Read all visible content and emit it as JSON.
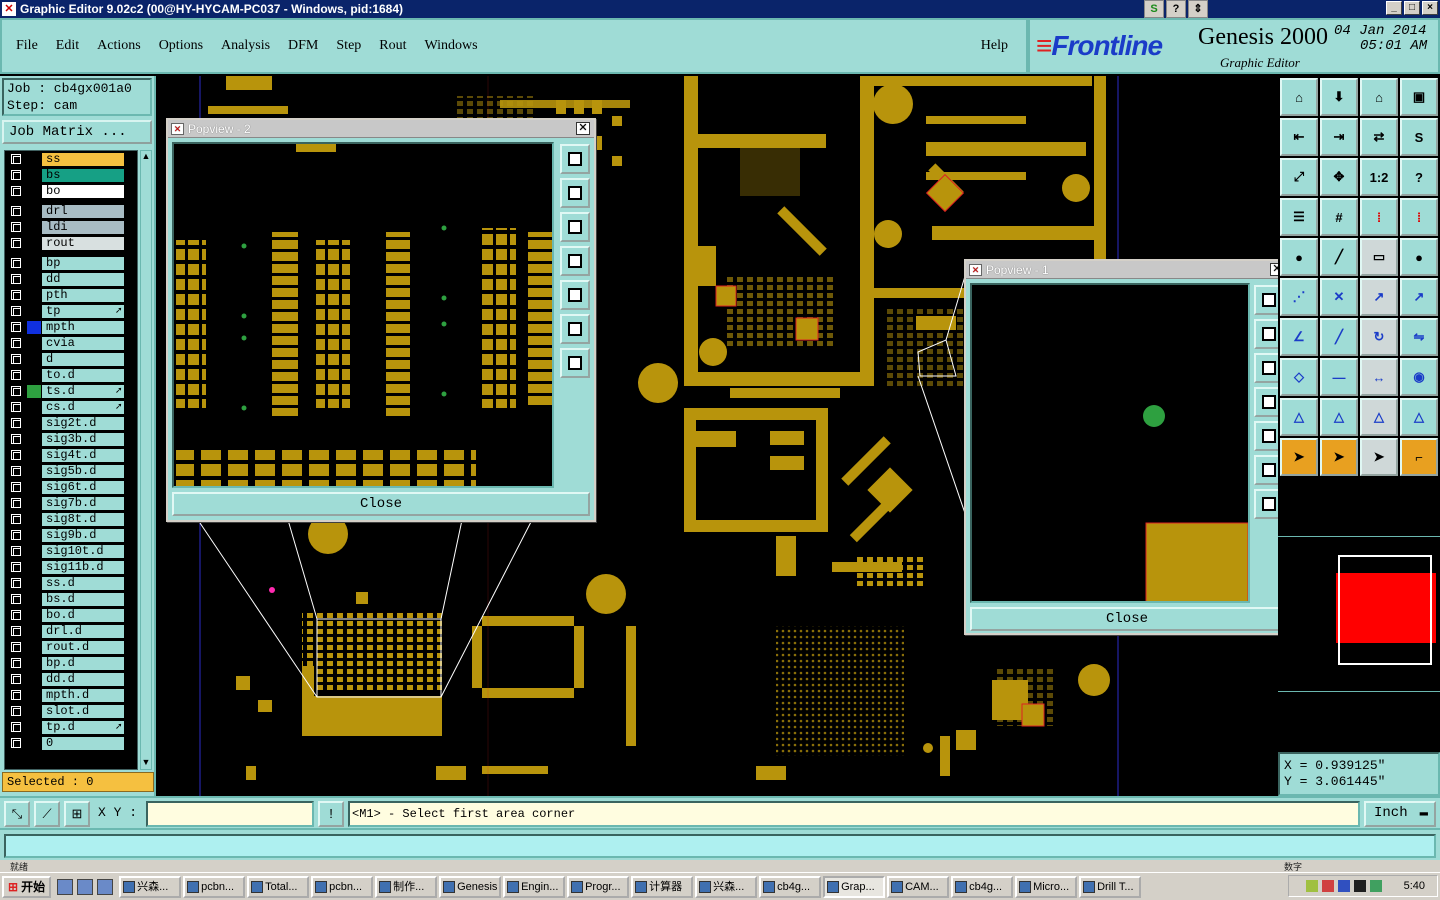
{
  "window": {
    "title": "Graphic Editor 9.02c2 (00@HY-HYCAM-PC037 - Windows, pid:1684)",
    "controls": [
      "_",
      "□",
      "×"
    ]
  },
  "menu": {
    "items": [
      "File",
      "Edit",
      "Actions",
      "Options",
      "Analysis",
      "DFM",
      "Step",
      "Rout",
      "Windows"
    ],
    "help": "Help"
  },
  "brand": {
    "logo": "Frontline",
    "product": "Genesis 2000",
    "date": "04 Jan 2014",
    "time": "05:01 AM",
    "subtitle": "Graphic Editor"
  },
  "job": {
    "job_line": "Job : cb4gx001a0",
    "step_line": "Step: cam",
    "matrix_button": "Job Matrix ..."
  },
  "layers": [
    {
      "name": "ss",
      "color": "#f5c040",
      "swatch": "#000000"
    },
    {
      "name": "bs",
      "color": "#16a085",
      "swatch": "#000000"
    },
    {
      "name": "bo",
      "color": "#ffffff",
      "swatch": "#000000"
    },
    {
      "name": "drl",
      "color": "#a8bcc4",
      "swatch": "#000000"
    },
    {
      "name": "ldi",
      "color": "#a8bcc4",
      "swatch": "#000000"
    },
    {
      "name": "rout",
      "color": "#d8e0e0",
      "swatch": "#000000"
    },
    {
      "name": "bp",
      "color": "#9fdcd6",
      "swatch": "#000000"
    },
    {
      "name": "dd",
      "color": "#9fdcd6",
      "swatch": "#000000"
    },
    {
      "name": "pth",
      "color": "#9fdcd6",
      "swatch": "#000000"
    },
    {
      "name": "tp",
      "color": "#9fdcd6",
      "swatch": "#000000",
      "arrow": true
    },
    {
      "name": "mpth",
      "color": "#9fdcd6",
      "swatch": "#1030e0"
    },
    {
      "name": "cvia",
      "color": "#9fdcd6",
      "swatch": "#000000"
    },
    {
      "name": "d",
      "color": "#9fdcd6",
      "swatch": "#000000"
    },
    {
      "name": "to.d",
      "color": "#9fdcd6",
      "swatch": "#000000"
    },
    {
      "name": "ts.d",
      "color": "#9fdcd6",
      "swatch": "#2ea040",
      "arrow": true
    },
    {
      "name": "cs.d",
      "color": "#9fdcd6",
      "swatch": "#000000",
      "arrow": true
    },
    {
      "name": "sig2t.d",
      "color": "#9fdcd6",
      "swatch": "#000000"
    },
    {
      "name": "sig3b.d",
      "color": "#9fdcd6",
      "swatch": "#000000"
    },
    {
      "name": "sig4t.d",
      "color": "#9fdcd6",
      "swatch": "#000000"
    },
    {
      "name": "sig5b.d",
      "color": "#9fdcd6",
      "swatch": "#000000"
    },
    {
      "name": "sig6t.d",
      "color": "#9fdcd6",
      "swatch": "#000000"
    },
    {
      "name": "sig7b.d",
      "color": "#9fdcd6",
      "swatch": "#000000"
    },
    {
      "name": "sig8t.d",
      "color": "#9fdcd6",
      "swatch": "#000000"
    },
    {
      "name": "sig9b.d",
      "color": "#9fdcd6",
      "swatch": "#000000"
    },
    {
      "name": "sig10t.d",
      "color": "#9fdcd6",
      "swatch": "#000000"
    },
    {
      "name": "sig11b.d",
      "color": "#9fdcd6",
      "swatch": "#000000"
    },
    {
      "name": "ss.d",
      "color": "#9fdcd6",
      "swatch": "#000000"
    },
    {
      "name": "bs.d",
      "color": "#9fdcd6",
      "swatch": "#000000"
    },
    {
      "name": "bo.d",
      "color": "#9fdcd6",
      "swatch": "#000000"
    },
    {
      "name": "drl.d",
      "color": "#9fdcd6",
      "swatch": "#000000"
    },
    {
      "name": "rout.d",
      "color": "#9fdcd6",
      "swatch": "#000000"
    },
    {
      "name": "bp.d",
      "color": "#9fdcd6",
      "swatch": "#000000"
    },
    {
      "name": "dd.d",
      "color": "#9fdcd6",
      "swatch": "#000000"
    },
    {
      "name": "mpth.d",
      "color": "#9fdcd6",
      "swatch": "#000000"
    },
    {
      "name": "slot.d",
      "color": "#9fdcd6",
      "swatch": "#000000"
    },
    {
      "name": "tp.d",
      "color": "#9fdcd6",
      "swatch": "#000000",
      "arrow": true
    },
    {
      "name": "0",
      "color": "#9fdcd6",
      "swatch": "#000000"
    }
  ],
  "selected": "Selected : 0",
  "popview2": {
    "title": "Popview - 2",
    "close": "Close"
  },
  "popview1": {
    "title": "Popview - 1",
    "close": "Close"
  },
  "tools": [
    {
      "icon": "home-icon",
      "glyph": "⌂"
    },
    {
      "icon": "save-icon",
      "glyph": "⬇"
    },
    {
      "icon": "house-icon",
      "glyph": "⌂"
    },
    {
      "icon": "window-icon",
      "glyph": "▣"
    },
    {
      "icon": "left-icon",
      "glyph": "⇤"
    },
    {
      "icon": "right-icon",
      "glyph": "⇥"
    },
    {
      "icon": "swap-icon",
      "glyph": "⇄"
    },
    {
      "icon": "s-icon",
      "glyph": "S"
    },
    {
      "icon": "zoom-fit-icon",
      "glyph": "⤢"
    },
    {
      "icon": "center-icon",
      "glyph": "✥"
    },
    {
      "icon": "ratio-icon",
      "glyph": "1:2"
    },
    {
      "icon": "help-icon",
      "glyph": "?"
    },
    {
      "icon": "settings-icon",
      "glyph": "☰"
    },
    {
      "icon": "grid-icon",
      "glyph": "#"
    },
    {
      "icon": "layers-red-icon",
      "glyph": "⁞"
    },
    {
      "icon": "layers-red2-icon",
      "glyph": "⁞"
    },
    {
      "icon": "pad-icon",
      "glyph": "●"
    },
    {
      "icon": "line-icon",
      "glyph": "╱"
    },
    {
      "icon": "ruler-icon",
      "glyph": "▭"
    },
    {
      "icon": "dot-icon",
      "glyph": "●"
    },
    {
      "icon": "connect-icon",
      "glyph": "⋰"
    },
    {
      "icon": "cross-icon",
      "glyph": "✕"
    },
    {
      "icon": "snap-icon",
      "glyph": "↗"
    },
    {
      "icon": "move-icon",
      "glyph": "↗"
    },
    {
      "icon": "angle-icon",
      "glyph": "∠"
    },
    {
      "icon": "slash-icon",
      "glyph": "╱"
    },
    {
      "icon": "rotate-icon",
      "glyph": "↻"
    },
    {
      "icon": "mirror-icon",
      "glyph": "⇋"
    },
    {
      "icon": "node-icon",
      "glyph": "◇"
    },
    {
      "icon": "hline-icon",
      "glyph": "―"
    },
    {
      "icon": "measure-icon",
      "glyph": "↔"
    },
    {
      "icon": "shapes-icon",
      "glyph": "◉"
    },
    {
      "icon": "triangle-icon",
      "glyph": "△"
    },
    {
      "icon": "triangle2-icon",
      "glyph": "△"
    },
    {
      "icon": "triangle3-icon",
      "glyph": "△"
    },
    {
      "icon": "triangle4-icon",
      "glyph": "△"
    },
    {
      "icon": "pointer-icon",
      "glyph": "➤"
    },
    {
      "icon": "pointer2-icon",
      "glyph": "➤"
    },
    {
      "icon": "pointer3-icon",
      "glyph": "➤"
    },
    {
      "icon": "path-icon",
      "glyph": "⌐"
    }
  ],
  "coords": {
    "x": "X = 0.939125\"",
    "y": "Y = 3.061445\""
  },
  "command": {
    "xy_label": "X Y :",
    "xy_value": "",
    "prompt": "<M1> - Select first area corner",
    "unit": "Inch"
  },
  "taskbar": {
    "start": "开始",
    "tasks": [
      "兴森...",
      "pcbn...",
      "Total...",
      "pcbn...",
      "制作...",
      "Genesis",
      "Engin...",
      "Progr...",
      "计算器",
      "兴森...",
      "cb4g...",
      "Grap...",
      "CAM...",
      "cb4g...",
      "Micro...",
      "Drill T..."
    ],
    "clock": "5:40"
  },
  "status_under_left": "就绪",
  "status_under_right": "数字"
}
